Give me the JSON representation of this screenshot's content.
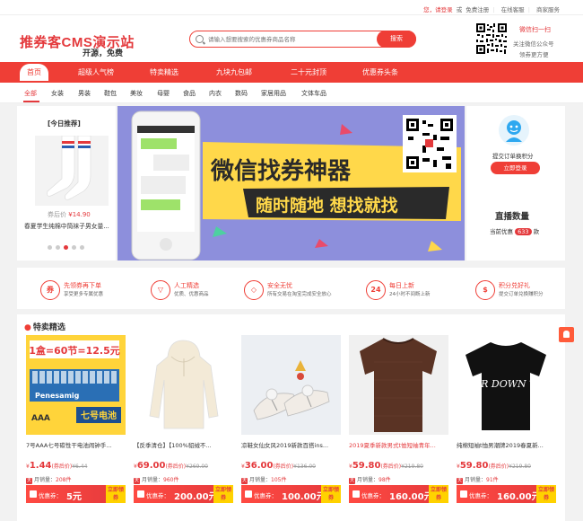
{
  "topbar": {
    "greeting": "您，请登录",
    "or": "或",
    "register": "免费注册",
    "online_service": "在线客服",
    "merchant": "商家服务"
  },
  "header": {
    "logo_title": "推券客CMS演示站",
    "logo_sub": "开源，免费",
    "search_placeholder": "请输入想要搜索的优惠券商品名称",
    "search_button": "搜索",
    "wechat_title": "微信扫一扫",
    "wechat_line1": "关注微信公众号",
    "wechat_line2": "领券更方便"
  },
  "nav": {
    "items": [
      "首页",
      "超级人气榜",
      "特卖精选",
      "九块九包邮",
      "二十元封顶",
      "优惠券头条"
    ]
  },
  "categories": {
    "items": [
      "全部",
      "女装",
      "男装",
      "鞋包",
      "美妆",
      "母婴",
      "食品",
      "内衣",
      "数码",
      "家居用品",
      "文体车品"
    ]
  },
  "today": {
    "title": "[今日推荐]",
    "price_label": "券后价",
    "price": "¥14.90",
    "name": "春夏学生纯棉中筒袜子男女量..."
  },
  "banner": {
    "title": "微信找券神器",
    "subtitle": "随时随地 想找就找"
  },
  "user_panel": {
    "exchange": "提交订单换积分",
    "login": "立即登录",
    "live_title": "直播数量",
    "live_prefix": "当前优惠",
    "live_count": "633",
    "live_suffix": "款"
  },
  "features": [
    {
      "icon": "券",
      "title": "先领券再下单",
      "desc": "享受更多专属优惠"
    },
    {
      "icon": "▽",
      "title": "人工精选",
      "desc": "优质、优惠商品"
    },
    {
      "icon": "◇",
      "title": "安全无忧",
      "desc": "所有交易在淘宝完成安全放心"
    },
    {
      "icon": "24",
      "title": "每日上新",
      "desc": "24小时不间断上新"
    },
    {
      "icon": "$",
      "title": "积分兑好礼",
      "desc": "提交订单兑换赚积分"
    }
  ],
  "section": {
    "title": "特卖精选",
    "icon": "flame-icon"
  },
  "products": [
    {
      "name": "7号AAA七号碳性干电池闹钟手...",
      "price": "1.44",
      "price_label": "(券后价)",
      "orig": "¥6.44",
      "sold_label": "月销量：",
      "sold": "208件",
      "coupon_label": "优惠券：",
      "coupon": "5元",
      "buy": "立即领券",
      "img_title": "1盒=60节=12.5元",
      "img_brand": "Penesamig",
      "img_battery": "七号电池",
      "img_tag": "AAA",
      "hot": false
    },
    {
      "name": "【反季清仓】【100%貂绒不...",
      "price": "69.00",
      "price_label": "(券后价)",
      "orig": "¥269.00",
      "sold_label": "月销量：",
      "sold": "960件",
      "coupon_label": "优惠券：",
      "coupon": "200.00元",
      "buy": "立即领券",
      "hot": false
    },
    {
      "name": "凉鞋女仙女风2019新款百搭ins...",
      "price": "36.00",
      "price_label": "(券后价)",
      "orig": "¥136.00",
      "sold_label": "月销量：",
      "sold": "105件",
      "coupon_label": "优惠券：",
      "coupon": "100.00元",
      "buy": "立即领券",
      "hot": false
    },
    {
      "name": "2019夏季新款男式t恤短袖青年...",
      "price": "59.80",
      "price_label": "(券后价)",
      "orig": "¥219.80",
      "sold_label": "月销量：",
      "sold": "98件",
      "coupon_label": "优惠券：",
      "coupon": "160.00元",
      "buy": "立即领券",
      "hot": true
    },
    {
      "name": "纯棉短袖t恤男潮牌2019春夏新...",
      "price": "59.80",
      "price_label": "(券后价)",
      "orig": "¥219.80",
      "sold_label": "月销量：",
      "sold": "91件",
      "coupon_label": "优惠券：",
      "coupon": "160.00元",
      "buy": "立即领券",
      "img_text": "TEAR DOWN THE",
      "hot": false
    }
  ],
  "colors": {
    "accent": "#ef3e36",
    "price": "#e4393c",
    "yellow": "#ffd200"
  }
}
